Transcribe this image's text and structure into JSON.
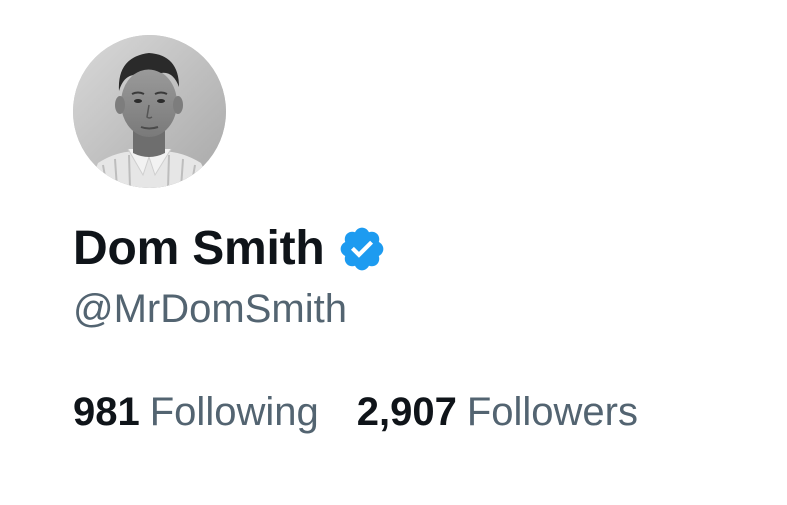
{
  "profile": {
    "display_name": "Dom Smith",
    "handle": "@MrDomSmith",
    "verified": true,
    "avatar_icon": "profile-photo",
    "verified_icon": "verified-badge-icon"
  },
  "stats": {
    "following_count": "981",
    "following_label": "Following",
    "followers_count": "2,907",
    "followers_label": "Followers"
  },
  "colors": {
    "text_primary": "#0f1419",
    "text_secondary": "#536471",
    "verified_blue": "#1d9bf0",
    "background": "#ffffff"
  }
}
